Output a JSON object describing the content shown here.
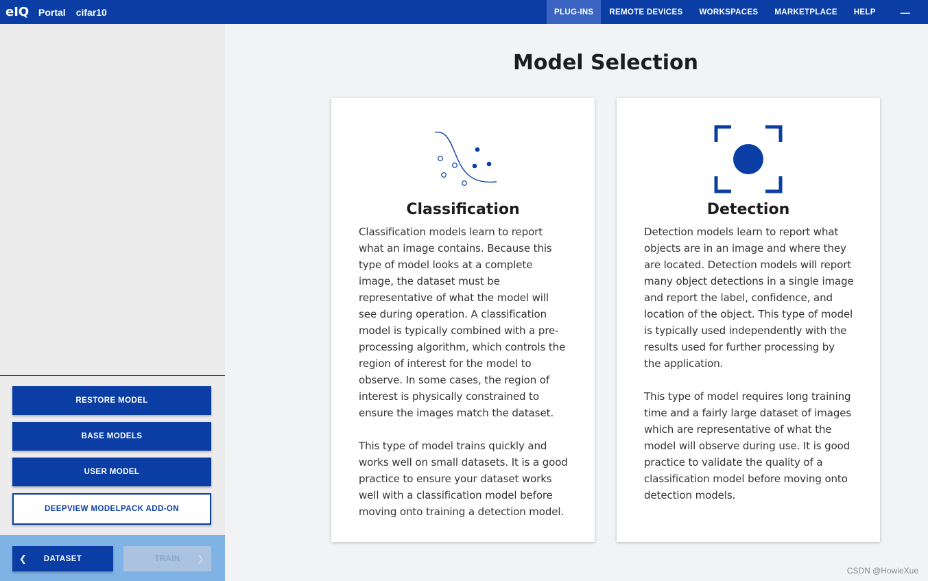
{
  "header": {
    "logo": "eIQ",
    "app_name": "Portal",
    "project": "cifar10",
    "nav": [
      {
        "label": "PLUG-INS",
        "active": true
      },
      {
        "label": "REMOTE DEVICES",
        "active": false
      },
      {
        "label": "WORKSPACES",
        "active": false
      },
      {
        "label": "MARKETPLACE",
        "active": false
      },
      {
        "label": "HELP",
        "active": false
      }
    ],
    "minimize_glyph": "—",
    "brand_color": "#0a3ea5"
  },
  "sidebar": {
    "restore_model": "RESTORE MODEL",
    "base_models": "BASE MODELS",
    "user_model": "USER MODEL",
    "deepview": "DEEPVIEW MODELPACK ADD-ON",
    "back_label": "DATASET",
    "next_label": "TRAIN"
  },
  "main": {
    "title": "Model Selection",
    "cards": [
      {
        "icon": "classification-scatter-icon",
        "title": "Classification",
        "paragraphs": [
          "Classification models learn to report what an image contains. Because this type of model looks at a complete image, the dataset must be representative of what the model will see during operation. A classification model is typically combined with a pre-processing algorithm, which controls the region of interest for the model to observe. In some cases, the region of interest is physically constrained to ensure the images match the dataset.",
          "This type of model trains quickly and works well on small datasets. It is a good practice to ensure your dataset works well with a classification model before moving onto training a detection model."
        ]
      },
      {
        "icon": "detection-target-icon",
        "title": "Detection",
        "paragraphs": [
          "Detection models learn to report what objects are in an image and where they are located. Detection models will report many object detections in a single image and report the label, confidence, and location of the object. This type of model is typically used independently with the results used for further processing by the application.",
          "This type of model requires long training time and a fairly large dataset of images which are representative of what the model will observe during use. It is good practice to validate the quality of a classification model before moving onto detection models."
        ]
      }
    ]
  },
  "watermark": "CSDN @HowieXue"
}
